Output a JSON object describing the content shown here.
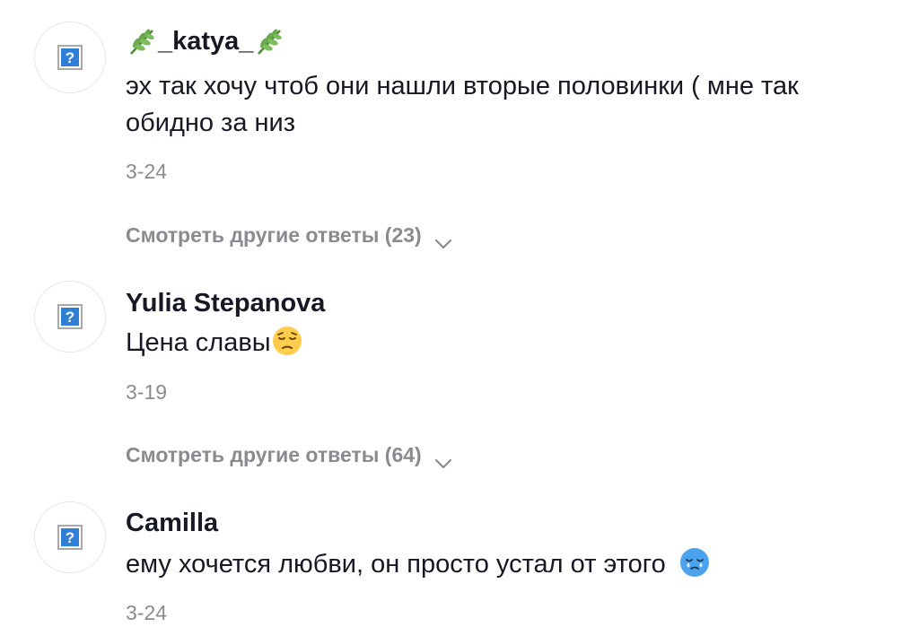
{
  "comments": [
    {
      "username": "_katya_",
      "text": "эх так хочу чтоб они нашли вторые половинки ( мне так обидно за низ",
      "date": "3-24",
      "more_replies_label": "Смотреть другие ответы (23)",
      "username_icons": [
        "herb-icon",
        "herb-icon"
      ]
    },
    {
      "username": "Yulia Stepanova",
      "text": "Цена славы",
      "date": "3-19",
      "more_replies_label": "Смотреть другие ответы (64)",
      "text_emoji": "pensive-face-emoji"
    },
    {
      "username": "Camilla",
      "text": "ему хочется любви, он просто устал от этого",
      "date": "3-24",
      "text_emoji": "crying-blue-face-sticker"
    }
  ],
  "avatar_placeholder_icon": "broken-image-question-icon",
  "colors": {
    "primary_text": "#161823",
    "secondary_text": "#8a8b91",
    "avatar_border": "#e6e6e8",
    "placeholder_blue": "#2f7fd6",
    "leaf_green": "#6aa84f",
    "sticker_blue": "#4aa3ec"
  }
}
